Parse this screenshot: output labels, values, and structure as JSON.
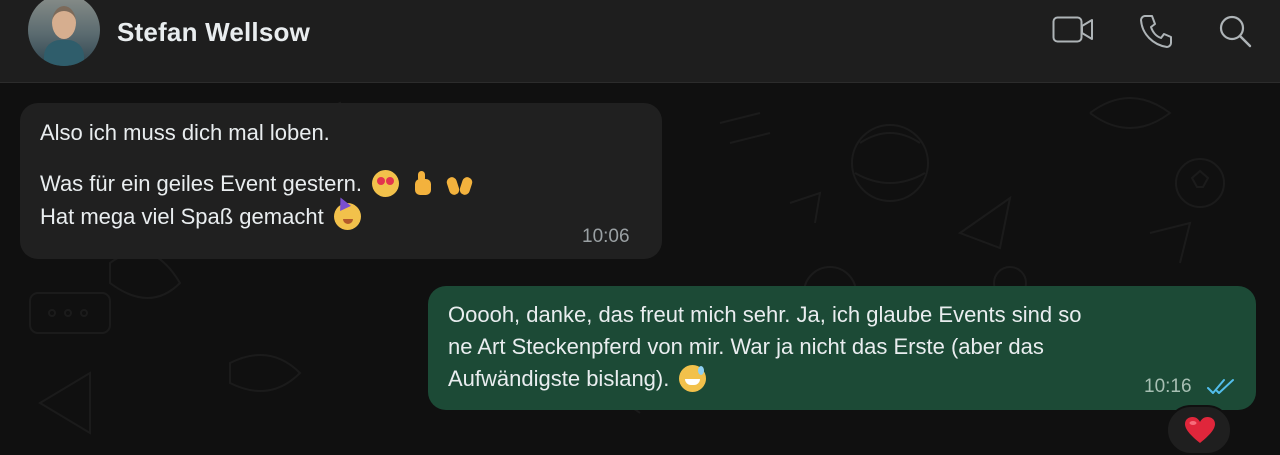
{
  "header": {
    "contact_name": "Stefan Wellsow",
    "avatar": "profile-photo",
    "icons": [
      "video-call-icon",
      "voice-call-icon",
      "search-icon"
    ]
  },
  "messages": [
    {
      "direction": "incoming",
      "lines": [
        "Also ich muss dich mal loben.",
        "",
        "Was für ein geiles Event gestern.",
        "Hat mega viel Spaß gemacht"
      ],
      "emojis": [
        "😍",
        "👍",
        "🙌",
        "🥳"
      ],
      "time": "10:06"
    },
    {
      "direction": "outgoing",
      "lines": [
        "Ooooh, danke, das freut mich sehr. Ja, ich glaube Events sind so",
        "ne Art Steckenpferd von mir. War ja nicht das Erste (aber das",
        "Aufwändigste bislang)."
      ],
      "emojis": [
        "😅"
      ],
      "time": "10:16",
      "status": "read-double-check",
      "reaction": "❤️"
    }
  ],
  "colors": {
    "header_bg": "#1e1e1e",
    "incoming_bubble": "#202020",
    "outgoing_bubble": "#1c4a36",
    "read_ticks": "#53bdeb",
    "heart": "#e0263b"
  }
}
